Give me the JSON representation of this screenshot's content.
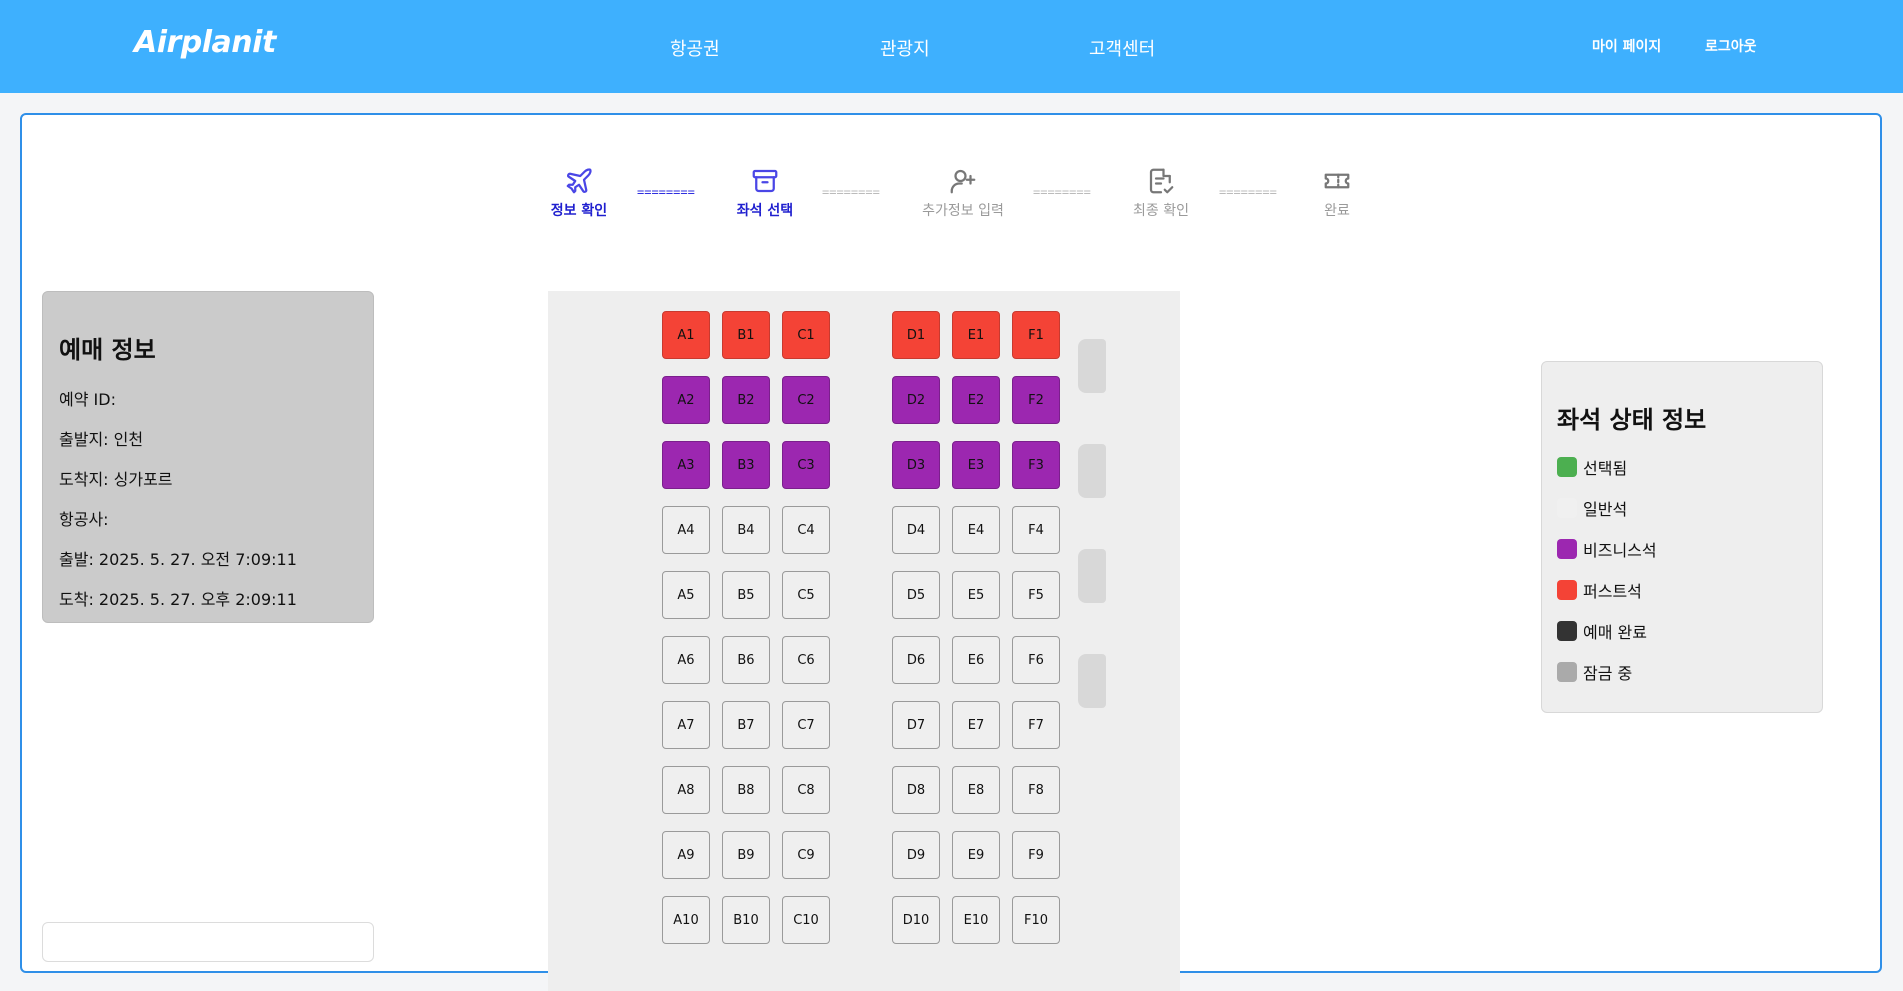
{
  "header": {
    "logo": "Airplanit",
    "nav": [
      "항공권",
      "관광지",
      "고객센터"
    ],
    "util": {
      "mypage": "마이 페이지",
      "logout": "로그아웃"
    }
  },
  "steps": [
    {
      "label": "정보 확인",
      "icon": "airplane-icon",
      "state": "active"
    },
    {
      "label": "좌석 선택",
      "icon": "archive-box-icon",
      "state": "active"
    },
    {
      "label": "추가정보 입력",
      "icon": "user-plus-icon",
      "state": "inactive"
    },
    {
      "label": "최종 확인",
      "icon": "document-check-icon",
      "state": "inactive"
    },
    {
      "label": "완료",
      "icon": "ticket-icon",
      "state": "inactive"
    }
  ],
  "connector_text": "========",
  "booking": {
    "title": "예매 정보",
    "rows": [
      "예약 ID:",
      "출발지: 인천",
      "도착지: 싱가포르",
      "항공사:",
      "출발: 2025. 5. 27. 오전 7:09:11",
      "도착: 2025. 5. 27. 오후 2:09:11"
    ]
  },
  "seats": {
    "left_columns": [
      "A",
      "B",
      "C"
    ],
    "right_columns": [
      "D",
      "E",
      "F"
    ],
    "rows": [
      1,
      2,
      3,
      4,
      5,
      6,
      7,
      8,
      9,
      10
    ],
    "first_rows": [
      1
    ],
    "business_rows": [
      2,
      3
    ]
  },
  "legend": {
    "title": "좌석 상태 정보",
    "items": [
      {
        "label": "선택됨",
        "color": "#4caf50"
      },
      {
        "label": "일반석",
        "color": "#f0f0f0"
      },
      {
        "label": "비즈니스석",
        "color": "#9c27b0"
      },
      {
        "label": "퍼스트석",
        "color": "#f44336"
      },
      {
        "label": "예매 완료",
        "color": "#333333"
      },
      {
        "label": "잠금 중",
        "color": "#aaaaaa"
      }
    ]
  }
}
